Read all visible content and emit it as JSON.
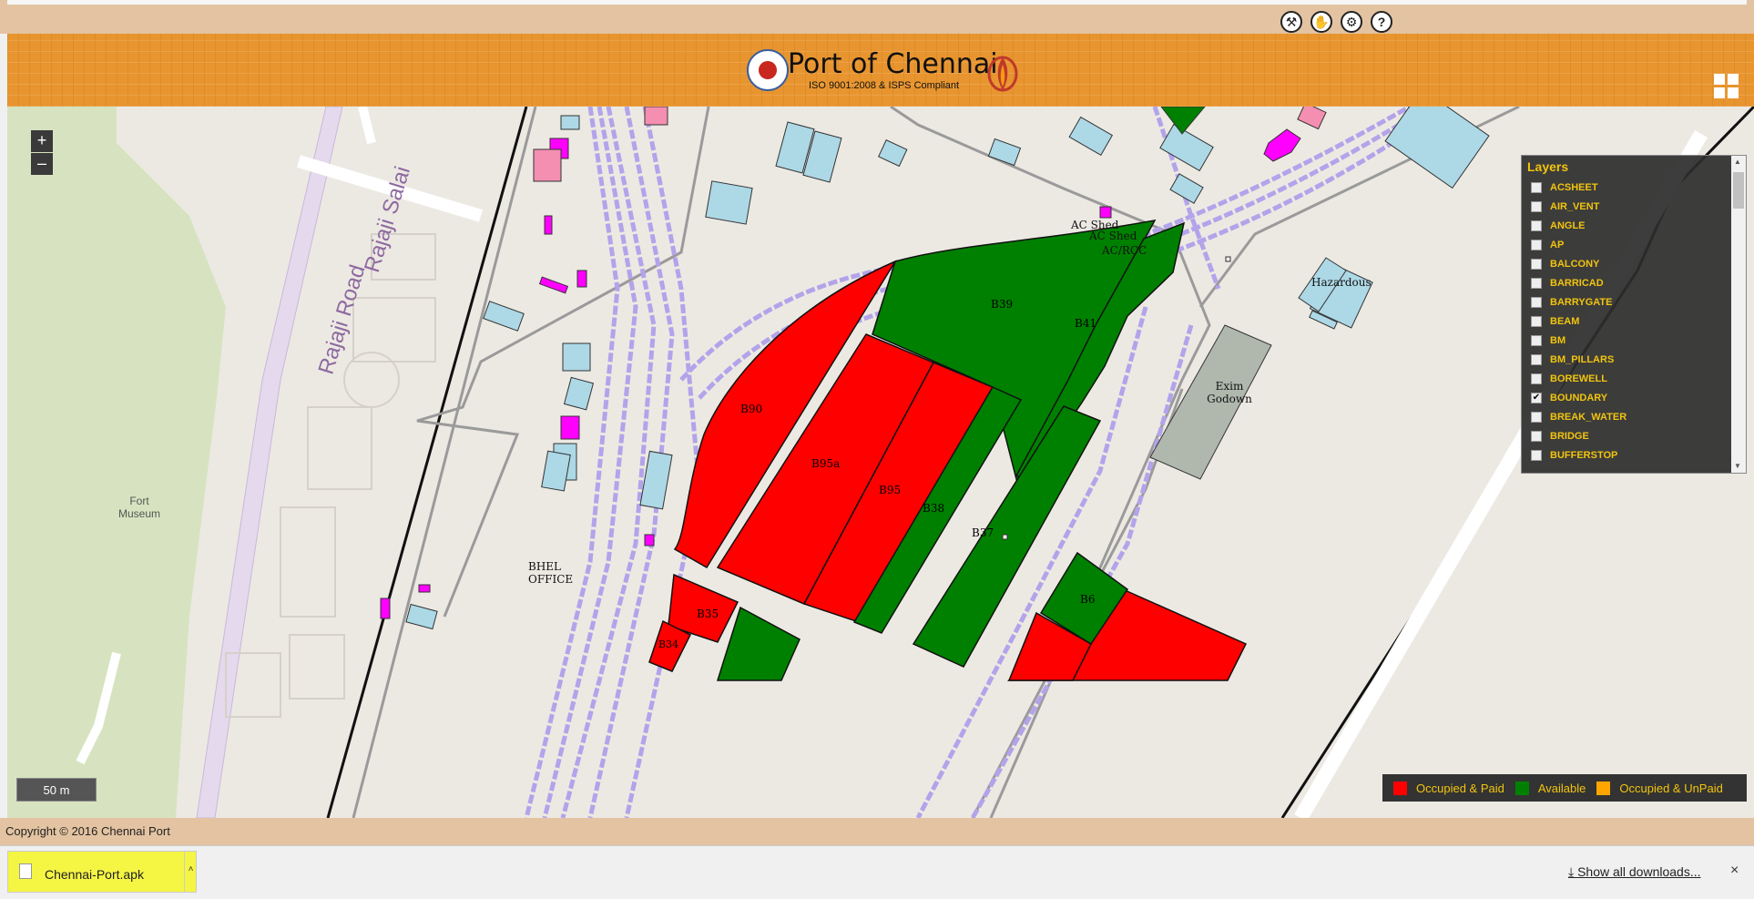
{
  "header": {
    "title": "Port of Chennai",
    "subtitle": "ISO 9001:2008 & ISPS Compliant"
  },
  "toolbar": {
    "icons": [
      "wrench-icon",
      "handshake-icon",
      "android-icon",
      "help-icon"
    ],
    "help_glyph": "?"
  },
  "map": {
    "zoom_in_label": "+",
    "zoom_out_label": "–",
    "scale_label": "50 m",
    "road_labels": [
      "Rajaji Road",
      "Rajaji Salai"
    ],
    "place_labels": {
      "fort_museum": "Fort Museum",
      "bhel_office": "BHEL OFFICE",
      "ac_shed_1": "AC Shed",
      "ac_shed_2": "AC Shed",
      "ac_rcc": "AC/RCC",
      "hazardous": "Hazardous",
      "exim_godown": "Exim Godown"
    },
    "plots": [
      {
        "id": "B90",
        "status": "Occupied & Paid"
      },
      {
        "id": "B95a",
        "status": "Occupied & Paid"
      },
      {
        "id": "B95",
        "status": "Occupied & Paid"
      },
      {
        "id": "B38",
        "status": "Available"
      },
      {
        "id": "B37",
        "status": "Available"
      },
      {
        "id": "B39",
        "status": "Available"
      },
      {
        "id": "B41",
        "status": "Available"
      },
      {
        "id": "B35",
        "status": "Occupied & Paid"
      },
      {
        "id": "B34",
        "status": "Occupied & Paid"
      },
      {
        "id": "B6",
        "status": "Available"
      }
    ]
  },
  "layers": {
    "title": "Layers",
    "items": [
      {
        "name": "ACSHEET",
        "checked": false
      },
      {
        "name": "AIR_VENT",
        "checked": false
      },
      {
        "name": "ANGLE",
        "checked": false
      },
      {
        "name": "AP",
        "checked": false
      },
      {
        "name": "BALCONY",
        "checked": false
      },
      {
        "name": "BARRICAD",
        "checked": false
      },
      {
        "name": "BARRYGATE",
        "checked": false
      },
      {
        "name": "BEAM",
        "checked": false
      },
      {
        "name": "BM",
        "checked": false
      },
      {
        "name": "BM_PILLARS",
        "checked": false
      },
      {
        "name": "BOREWELL",
        "checked": false
      },
      {
        "name": "BOUNDARY",
        "checked": true
      },
      {
        "name": "BREAK_WATER",
        "checked": false
      },
      {
        "name": "BRIDGE",
        "checked": false
      },
      {
        "name": "BUFFERSTOP",
        "checked": false
      }
    ]
  },
  "legend": {
    "items": [
      {
        "label": "Occupied & Paid",
        "color": "#ff0000"
      },
      {
        "label": "Available",
        "color": "#008000"
      },
      {
        "label": "Occupied & UnPaid",
        "color": "#ffa500"
      }
    ]
  },
  "colors": {
    "occupied_paid": "#ff0000",
    "available": "#008000",
    "building": "#add8e6",
    "magenta": "#ff00ff",
    "rail": "#b3a3ea",
    "park": "#d7e3c0"
  },
  "footer": {
    "copyright": "Copyright © 2016 Chennai Port"
  },
  "downloads": {
    "file_name": "Chennai-Port.apk",
    "show_all": "Show all downloads...",
    "close_glyph": "×"
  }
}
